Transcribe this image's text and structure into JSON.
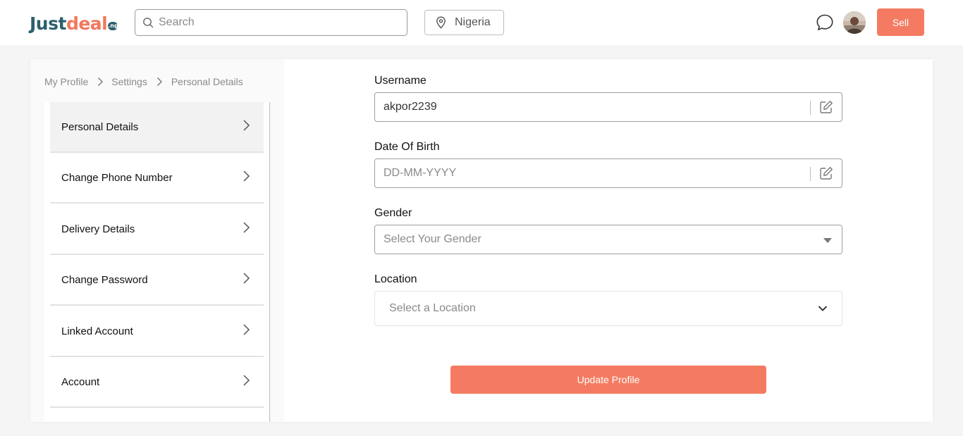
{
  "brand": {
    "name_part1": "Just",
    "name_part2": "deal",
    "badge": ".ng"
  },
  "header": {
    "search_placeholder": "Search",
    "location": "Nigeria",
    "sell_label": "Sell"
  },
  "breadcrumb": [
    "My Profile",
    "Settings",
    "Personal Details"
  ],
  "menu": {
    "items": [
      {
        "label": "Personal Details",
        "active": true
      },
      {
        "label": "Change Phone Number"
      },
      {
        "label": "Delivery Details"
      },
      {
        "label": "Change Password"
      },
      {
        "label": "Linked Account"
      },
      {
        "label": "Account"
      }
    ]
  },
  "form": {
    "username": {
      "label": "Username",
      "value": "akpor2239"
    },
    "dob": {
      "label": "Date Of Birth",
      "placeholder": "DD-MM-YYYY"
    },
    "gender": {
      "label": "Gender",
      "placeholder": "Select Your Gender"
    },
    "location": {
      "label": "Location",
      "placeholder": "Select a Location"
    },
    "submit_label": "Update Profile"
  },
  "colors": {
    "accent": "#f47b61",
    "brand_dark": "#2c5f6e"
  }
}
